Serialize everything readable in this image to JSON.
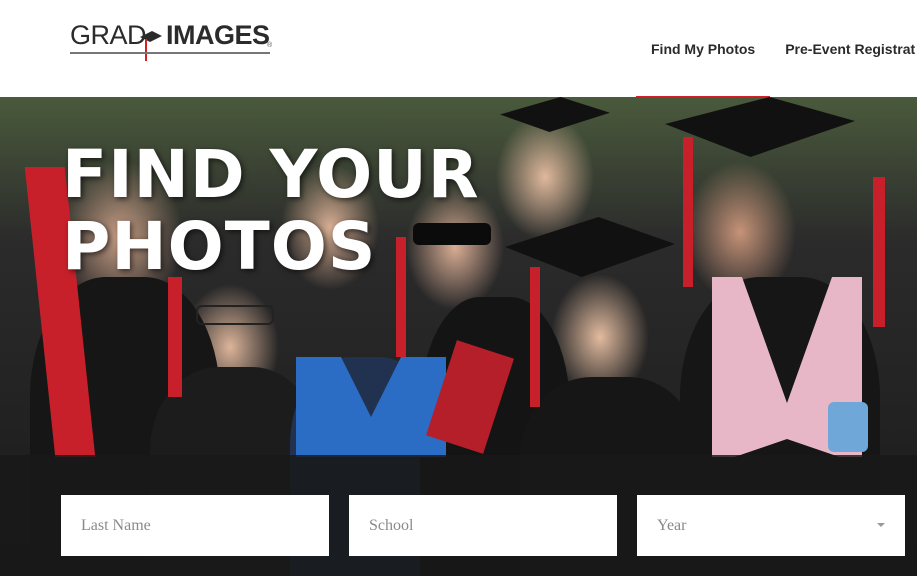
{
  "brand": {
    "logo_left": "GRAD",
    "logo_right": "IMAGES",
    "trademark": "®",
    "accent_color": "#d42027"
  },
  "nav": {
    "items": [
      {
        "label": "Find My Photos",
        "active": true
      },
      {
        "label": "Pre-Event Registrat",
        "active": false
      }
    ]
  },
  "hero": {
    "title_line1": "FIND YOUR",
    "title_line2": "PHOTOS"
  },
  "search": {
    "last_name": {
      "placeholder": "Last Name",
      "value": ""
    },
    "school": {
      "placeholder": "School",
      "value": ""
    },
    "year": {
      "selected": "Year"
    }
  }
}
